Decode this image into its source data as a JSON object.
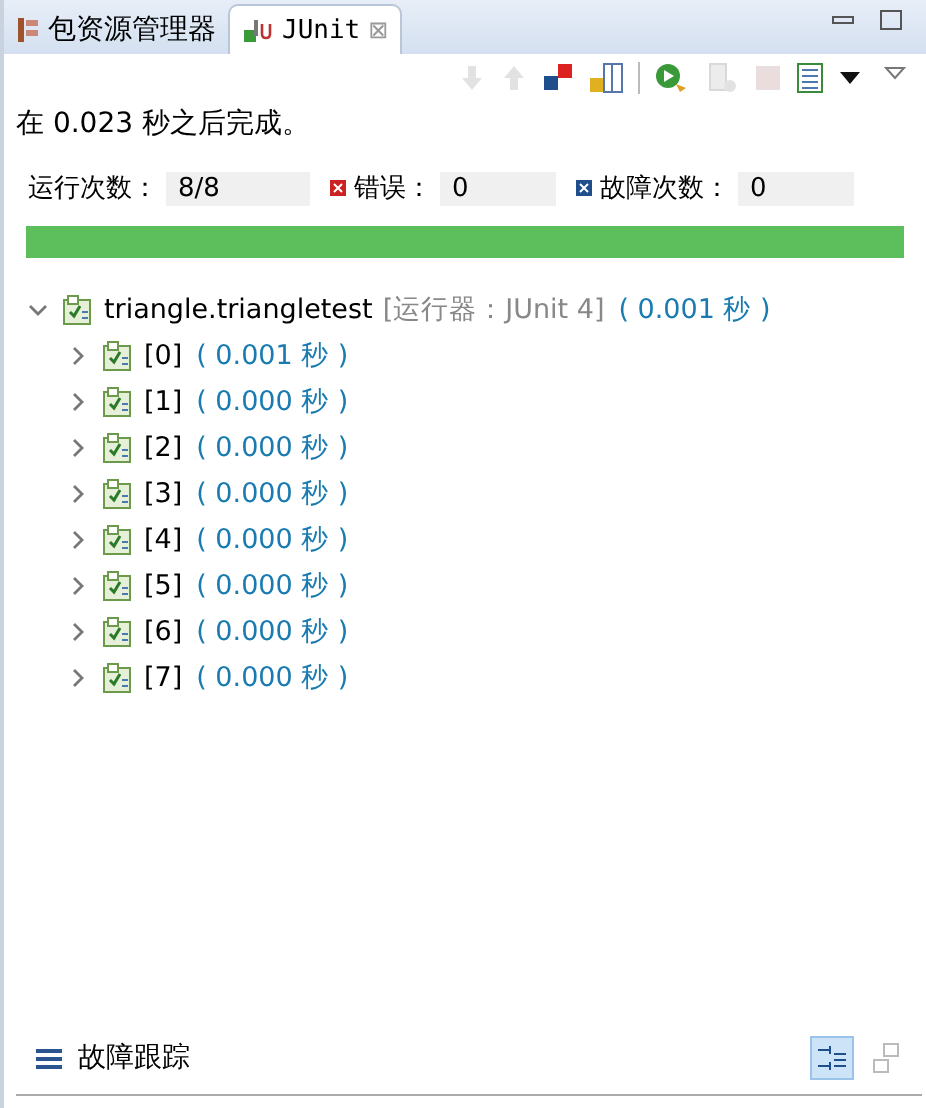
{
  "tabs": [
    {
      "label": "包资源管理器",
      "kind": "package",
      "selected": false
    },
    {
      "label": "JUnit",
      "kind": "junit",
      "selected": true,
      "close": "⊠"
    }
  ],
  "toolbar": [
    {
      "kind": "down",
      "disabled": true
    },
    {
      "kind": "up",
      "disabled": true
    },
    {
      "kind": "failures",
      "disabled": false
    },
    {
      "kind": "lock",
      "disabled": false
    },
    {
      "kind": "rerun",
      "disabled": false
    },
    {
      "kind": "rerunfail",
      "disabled": true
    },
    {
      "kind": "stop",
      "disabled": true
    },
    {
      "kind": "history",
      "disabled": false
    },
    {
      "kind": "menu",
      "disabled": false
    }
  ],
  "status": "在 0.023 秒之后完成。",
  "counters": [
    {
      "kind": "runs",
      "label": "运行次数：",
      "value": "8/8"
    },
    {
      "kind": "errors",
      "label": "错误：",
      "value": "0"
    },
    {
      "kind": "failures",
      "label": "故障次数：",
      "value": "0"
    }
  ],
  "progress": {
    "level": 1,
    "ok": true
  },
  "tree": [
    {
      "label": "triangle.triangletest",
      "runner": "[运行器：JUnit 4]",
      "time": "( 0.001 秒 )",
      "expanded": true,
      "children": [
        {
          "label": "[0]",
          "time": "( 0.001 秒 )",
          "expanded": false
        },
        {
          "label": "[1]",
          "time": "( 0.000 秒 )",
          "expanded": false
        },
        {
          "label": "[2]",
          "time": "( 0.000 秒 )",
          "expanded": false
        },
        {
          "label": "[3]",
          "time": "( 0.000 秒 )",
          "expanded": false
        },
        {
          "label": "[4]",
          "time": "( 0.000 秒 )",
          "expanded": false
        },
        {
          "label": "[5]",
          "time": "( 0.000 秒 )",
          "expanded": false
        },
        {
          "label": "[6]",
          "time": "( 0.000 秒 )",
          "expanded": false
        },
        {
          "label": "[7]",
          "time": "( 0.000 秒 )",
          "expanded": false
        }
      ]
    }
  ],
  "trace": {
    "title": "故障跟踪",
    "buttons": [
      {
        "kind": "filter",
        "selected": true
      },
      {
        "kind": "compare",
        "selected": false
      }
    ]
  }
}
